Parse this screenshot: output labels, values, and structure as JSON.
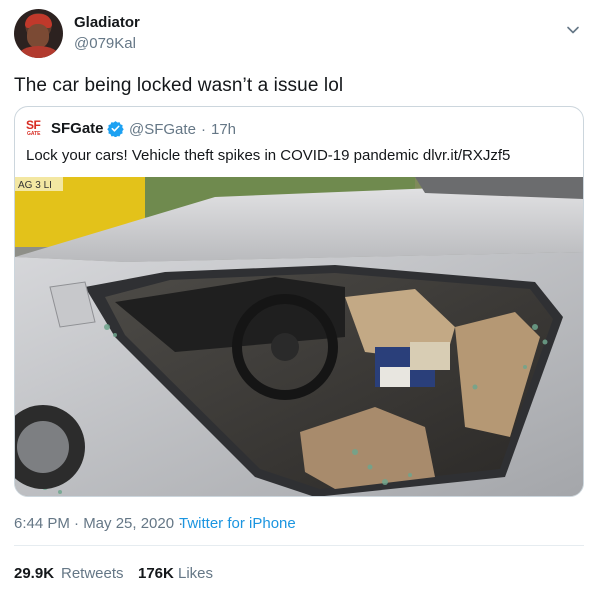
{
  "author": {
    "display_name": "Gladiator",
    "handle": "@079Kal",
    "avatar_icon": "profile-avatar"
  },
  "menu_icon": "chevron-down-icon",
  "tweet_text": "The car being locked wasn’t a issue lol",
  "quoted_tweet": {
    "logo_icon": "sfgate-logo",
    "logo_text": "SF",
    "logo_subtext": "GATE",
    "display_name": "SFGate",
    "verified_icon": "verified-badge-icon",
    "handle": "@SFGate",
    "separator": "·",
    "time": "17h",
    "text": "Lock your cars! Vehicle theft spikes in COVID-19 pandemic dlvr.it/RXJzf5",
    "image_plate_text": "AG 3 LI"
  },
  "meta": {
    "timestamp": "6:44 PM · May 25, 2020 ·",
    "source": "Twitter for iPhone"
  },
  "stats": {
    "retweets_count": "29.9K",
    "retweets_label": "Retweets",
    "likes_count": "176K",
    "likes_label": "Likes"
  },
  "colors": {
    "link": "#1b95e0",
    "secondary_text": "#657786",
    "primary_text": "#14171a",
    "border": "#ccd6dd"
  }
}
